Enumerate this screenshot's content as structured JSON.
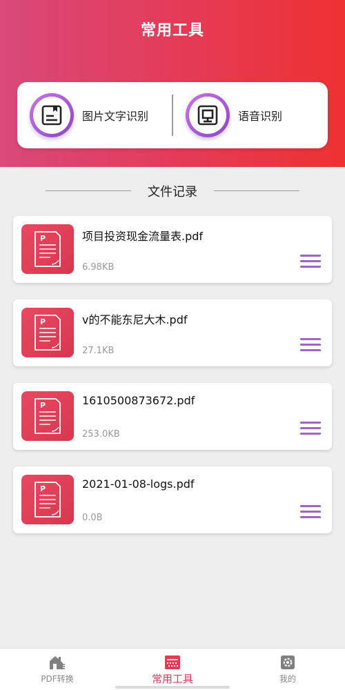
{
  "header": {
    "title": "常用工具"
  },
  "tools": [
    {
      "label": "图片文字识别",
      "icon": "image-text-ocr-icon"
    },
    {
      "label": "语音识别",
      "icon": "speech-recognition-icon"
    }
  ],
  "records": {
    "title": "文件记录",
    "files": [
      {
        "name": "项目投资现金流量表.pdf",
        "size": "6.98KB"
      },
      {
        "name": "v的不能东尼大木.pdf",
        "size": "27.1KB"
      },
      {
        "name": "1610500873672.pdf",
        "size": "253.0KB"
      },
      {
        "name": "2021-01-08-logs.pdf",
        "size": "0.0B"
      }
    ]
  },
  "tabbar": {
    "items": [
      {
        "label": "PDF转换",
        "icon": "pdf-convert-icon",
        "active": false
      },
      {
        "label": "常用工具",
        "icon": "tools-icon",
        "active": true
      },
      {
        "label": "我的",
        "icon": "gear-icon",
        "active": false
      }
    ]
  },
  "colors": {
    "header_gradient_start": "#d9497a",
    "header_gradient_end": "#ee3232",
    "tool_circle": "#8a45c9",
    "file_icon": "#e23c57",
    "menu_icon": "#a062c6",
    "tab_active": "#e23c57",
    "tab_inactive": "#888888"
  }
}
